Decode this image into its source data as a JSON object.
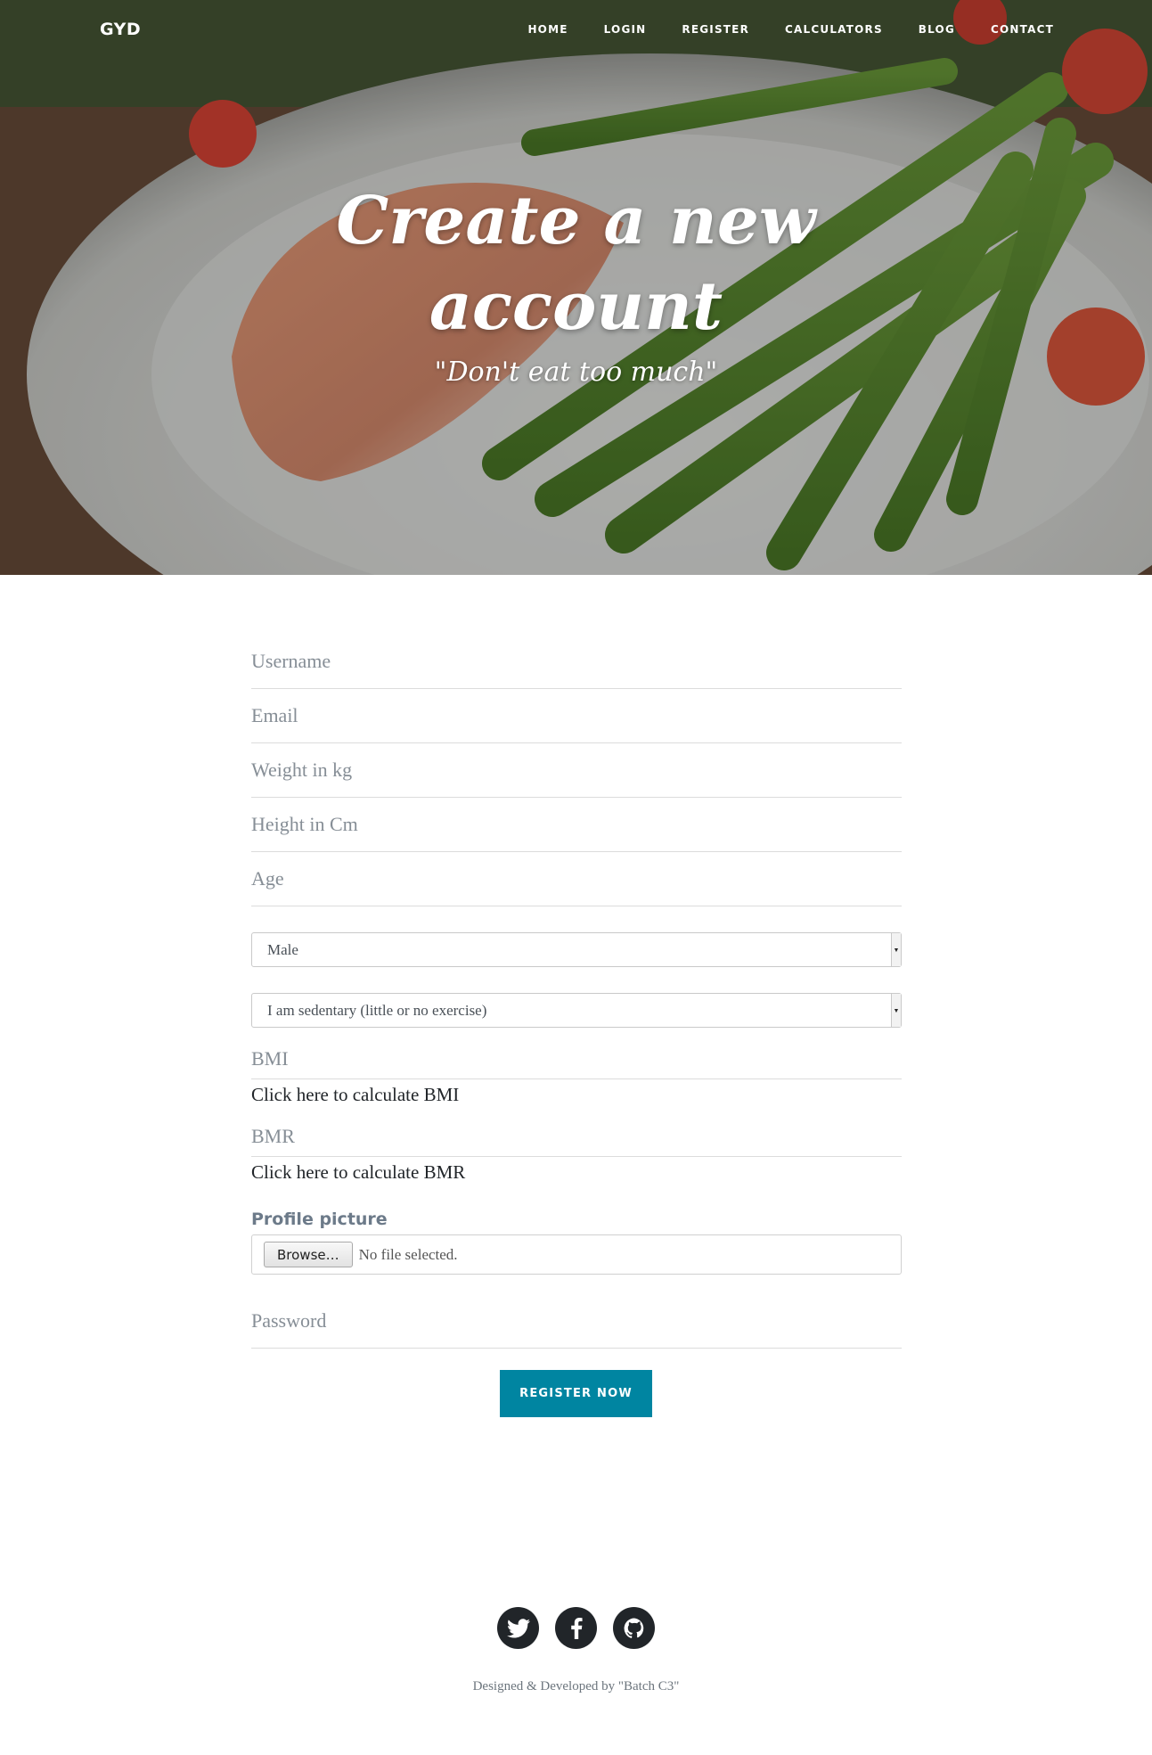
{
  "navbar": {
    "brand": "GYD",
    "links": [
      "HOME",
      "LOGIN",
      "REGISTER",
      "CALCULATORS",
      "BLOG",
      "CONTACT"
    ]
  },
  "hero": {
    "title_line1": "Create a new",
    "title_line2": "account",
    "subtitle": "\"Don't eat too much\""
  },
  "form": {
    "username_placeholder": "Username",
    "email_placeholder": "Email",
    "weight_placeholder": "Weight in kg",
    "height_placeholder": "Height in Cm",
    "age_placeholder": "Age",
    "gender_selected": "Male",
    "activity_selected": "I am sedentary (little or no exercise)",
    "bmi_label": "BMI",
    "bmi_link": "Click here to calculate BMI",
    "bmr_label": "BMR",
    "bmr_link": "Click here to calculate BMR",
    "profile_label": "Profile picture",
    "browse_label": "Browse…",
    "file_status": "No file selected.",
    "password_placeholder": "Password",
    "submit_label": "REGISTER NOW"
  },
  "footer": {
    "social_icons": [
      "twitter-icon",
      "facebook-icon",
      "github-icon"
    ],
    "credit": "Designed & Developed by \"Batch C3\""
  },
  "colors": {
    "accent": "#0085a1",
    "footer_icon_bg": "#212529"
  }
}
